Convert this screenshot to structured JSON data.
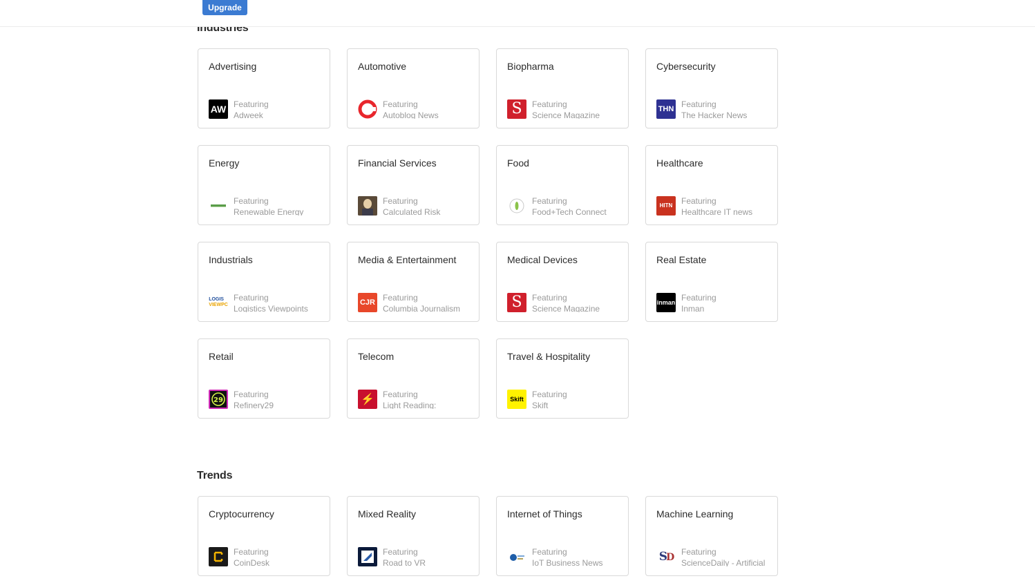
{
  "header": {
    "upgrade_label": "Upgrade"
  },
  "industries": {
    "title": "Industries",
    "cards": [
      {
        "title": "Advertising",
        "featuring": "Featuring",
        "source": "Adweek",
        "logo_icon": "adweek-logo-icon",
        "logo_text": "AW",
        "logo_bg": "#000000",
        "logo_fg": "#ffffff"
      },
      {
        "title": "Automotive",
        "featuring": "Featuring",
        "source": "Autoblog News",
        "logo_icon": "autoblog-logo-icon",
        "logo_text": "",
        "logo_bg": "#ffffff",
        "logo_fg": "#e8262c"
      },
      {
        "title": "Biopharma",
        "featuring": "Featuring",
        "source": "Science Magazine",
        "logo_icon": "science-magazine-logo-icon",
        "logo_text": "S",
        "logo_bg": "#d0202c",
        "logo_fg": "#ffffff"
      },
      {
        "title": "Cybersecurity",
        "featuring": "Featuring",
        "source": "The Hacker News",
        "logo_icon": "hacker-news-logo-icon",
        "logo_text": "THN",
        "logo_bg": "#2e3192",
        "logo_fg": "#ffffff"
      },
      {
        "title": "Energy",
        "featuring": "Featuring",
        "source": "Renewable Energy",
        "logo_icon": "renewable-energy-logo-icon",
        "logo_text": "",
        "logo_bg": "#ffffff",
        "logo_fg": "#3a8c3a"
      },
      {
        "title": "Financial Services",
        "featuring": "Featuring",
        "source": "Calculated Risk",
        "logo_icon": "calculated-risk-logo-icon",
        "logo_text": "",
        "logo_bg": "#6b5a45",
        "logo_fg": "#d9c6a5"
      },
      {
        "title": "Food",
        "featuring": "Featuring",
        "source": "Food+Tech Connect",
        "logo_icon": "food-tech-connect-logo-icon",
        "logo_text": "",
        "logo_bg": "#ffffff",
        "logo_fg": "#6aa84f"
      },
      {
        "title": "Healthcare",
        "featuring": "Featuring",
        "source": "Healthcare IT news",
        "logo_icon": "healthcare-it-news-logo-icon",
        "logo_text": "HITN",
        "logo_bg": "#c9321f",
        "logo_fg": "#ffffff"
      },
      {
        "title": "Industrials",
        "featuring": "Featuring",
        "source": "Logistics Viewpoints",
        "logo_icon": "logistics-viewpoints-logo-icon",
        "logo_text": "LOGIS",
        "logo_bg": "#ffffff",
        "logo_fg": "#1f4e9c"
      },
      {
        "title": "Media & Entertainment",
        "featuring": "Featuring",
        "source": "Columbia Journalism",
        "logo_icon": "cjr-logo-icon",
        "logo_text": "CJR",
        "logo_bg": "#e8472a",
        "logo_fg": "#ffffff"
      },
      {
        "title": "Medical Devices",
        "featuring": "Featuring",
        "source": "Science Magazine",
        "logo_icon": "science-magazine-logo-icon",
        "logo_text": "S",
        "logo_bg": "#d0202c",
        "logo_fg": "#ffffff"
      },
      {
        "title": "Real Estate",
        "featuring": "Featuring",
        "source": "Inman",
        "logo_icon": "inman-logo-icon",
        "logo_text": "inman",
        "logo_bg": "#000000",
        "logo_fg": "#ffffff"
      },
      {
        "title": "Retail",
        "featuring": "Featuring",
        "source": "Refinery29",
        "logo_icon": "refinery29-logo-icon",
        "logo_text": "29",
        "logo_bg": "#111111",
        "logo_fg": "#d4f24a"
      },
      {
        "title": "Telecom",
        "featuring": "Featuring",
        "source": "Light Reading:",
        "logo_icon": "light-reading-logo-icon",
        "logo_text": "⚡",
        "logo_bg": "#c8102e",
        "logo_fg": "#ffffff"
      },
      {
        "title": "Travel & Hospitality",
        "featuring": "Featuring",
        "source": "Skift",
        "logo_icon": "skift-logo-icon",
        "logo_text": "Skift",
        "logo_bg": "#fff200",
        "logo_fg": "#000000"
      }
    ]
  },
  "trends": {
    "title": "Trends",
    "cards": [
      {
        "title": "Cryptocurrency",
        "featuring": "Featuring",
        "source": "CoinDesk",
        "logo_icon": "coindesk-logo-icon",
        "logo_text": "",
        "logo_bg": "#1a1a1a",
        "logo_fg": "#f5b400"
      },
      {
        "title": "Mixed Reality",
        "featuring": "Featuring",
        "source": "Road to VR",
        "logo_icon": "road-to-vr-logo-icon",
        "logo_text": "",
        "logo_bg": "#0b1a3a",
        "logo_fg": "#4f8fd6"
      },
      {
        "title": "Internet of Things",
        "featuring": "Featuring",
        "source": "IoT Business News",
        "logo_icon": "iot-business-news-logo-icon",
        "logo_text": "",
        "logo_bg": "#ffffff",
        "logo_fg": "#1f5ea8"
      },
      {
        "title": "Machine Learning",
        "featuring": "Featuring",
        "source": "ScienceDaily - Artificial",
        "logo_icon": "sciencedaily-logo-icon",
        "logo_text": "SD",
        "logo_bg": "#ffffff",
        "logo_fg": "#2e3b7a"
      }
    ]
  }
}
